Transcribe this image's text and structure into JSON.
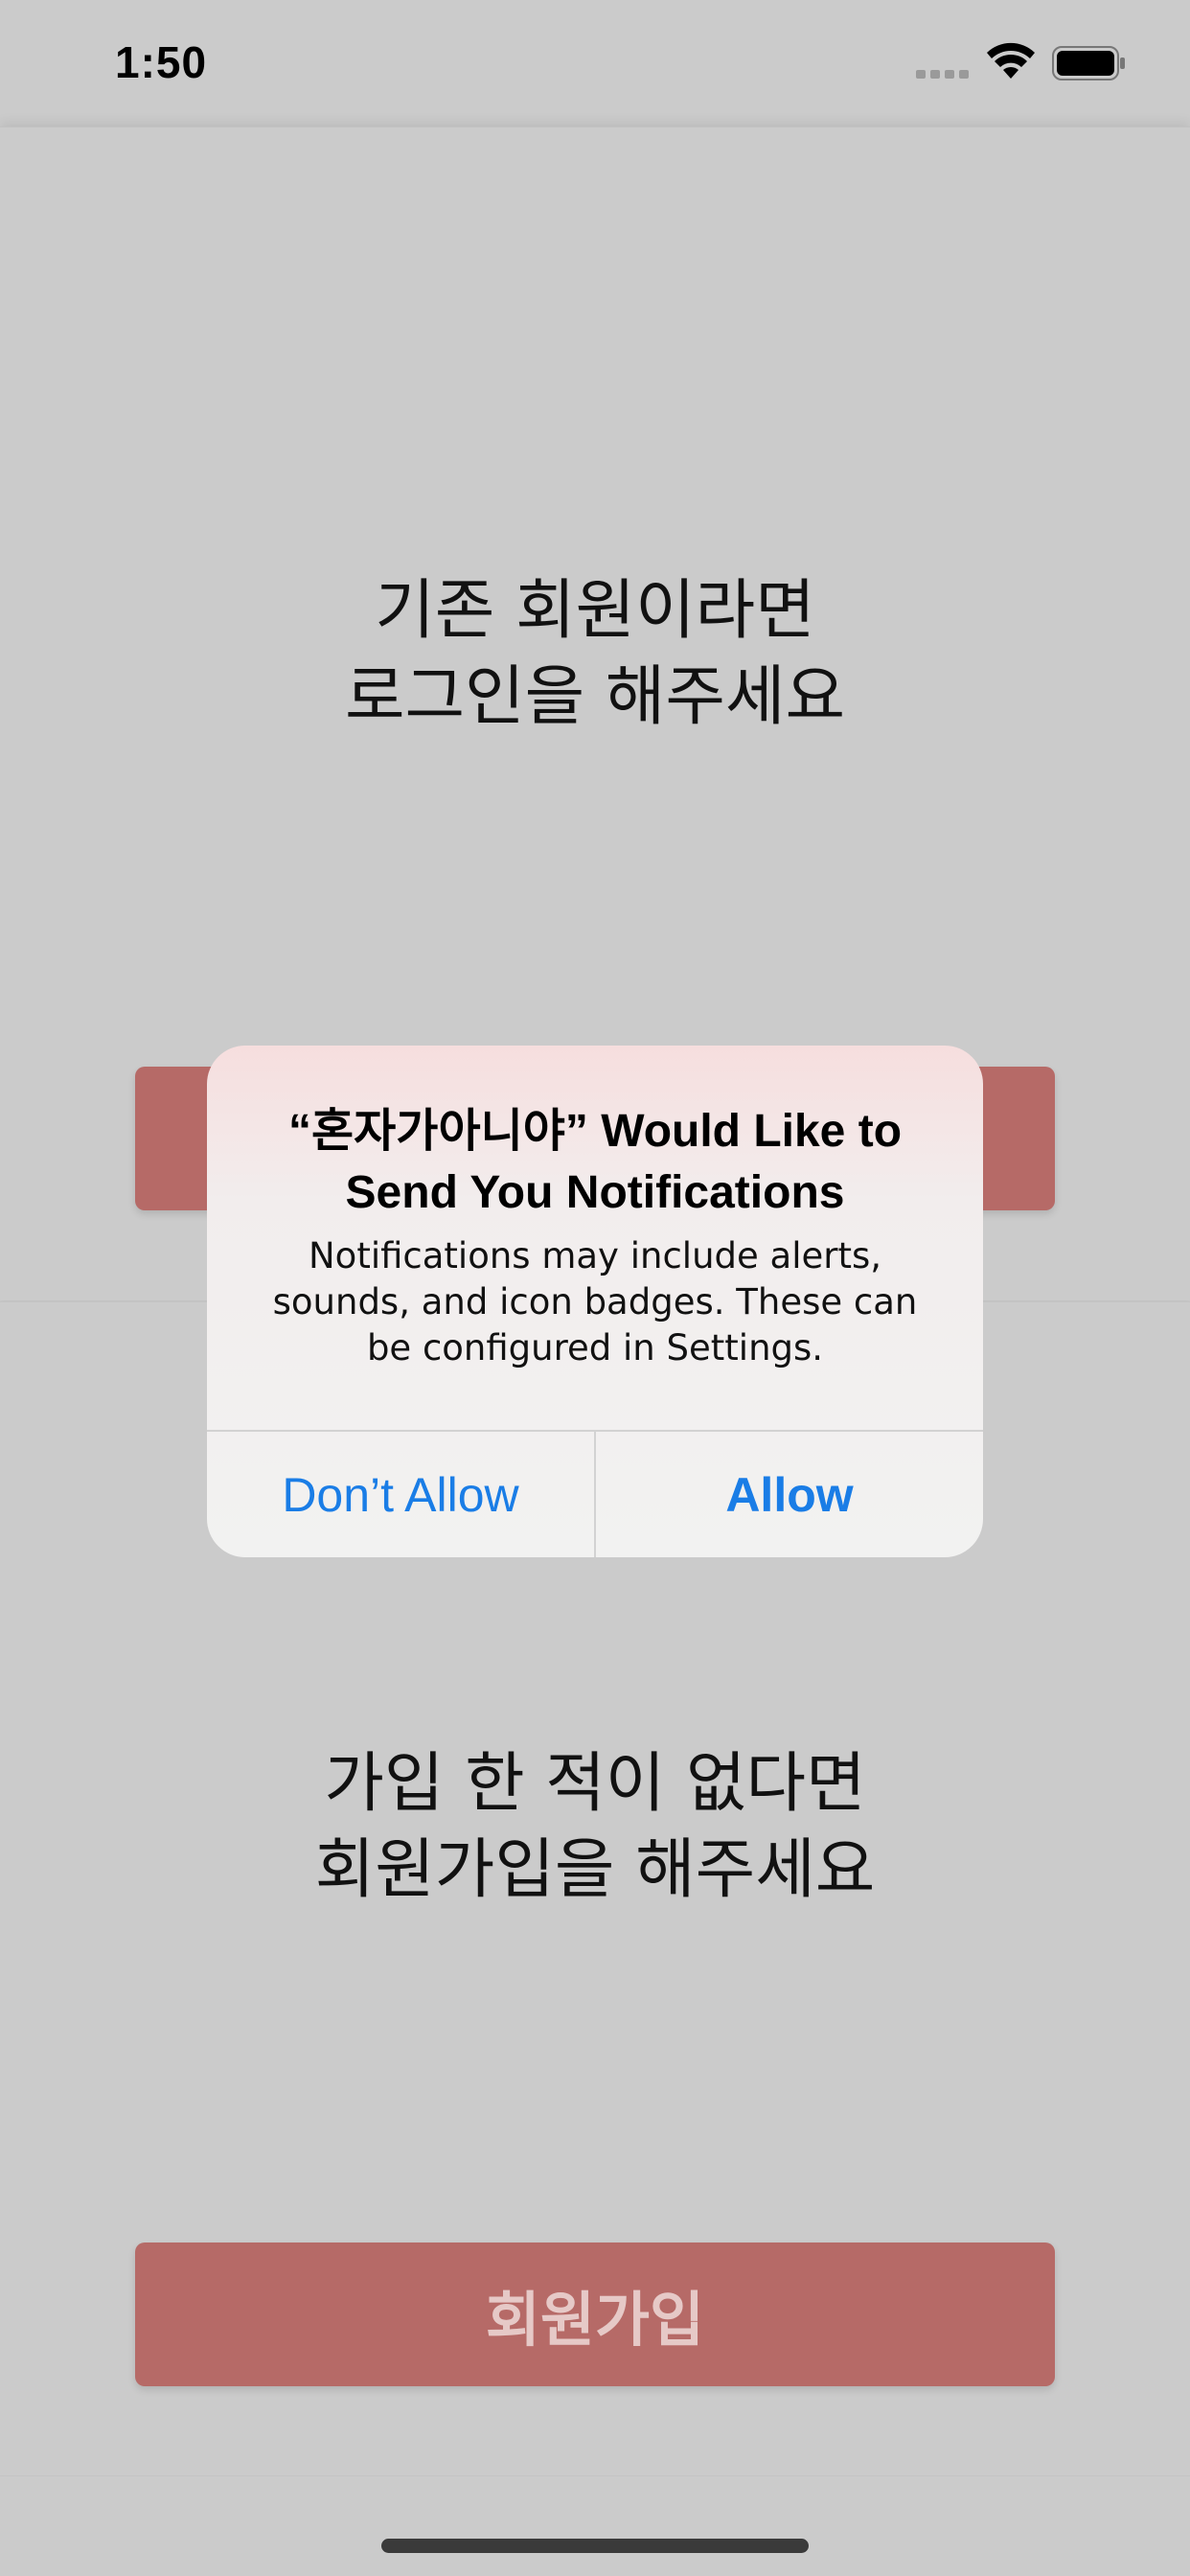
{
  "status_bar": {
    "time": "1:50",
    "icons": [
      "signal-icon",
      "wifi-icon",
      "battery-icon"
    ]
  },
  "login_section": {
    "prompt_lines": [
      "기존 회원이라면",
      "로그인을 해주세요"
    ]
  },
  "signup_section": {
    "prompt_lines": [
      "가입 한 적이 없다면",
      "회원가입을 해주세요"
    ],
    "button_label": "회원가입"
  },
  "alert": {
    "title_lines": [
      "“혼자가아니야” Would Like to",
      "Send You Notifications"
    ],
    "message_lines": [
      "Notifications may include alerts,",
      "sounds, and icon badges. These can",
      "be configured in Settings."
    ],
    "dont_allow_label": "Don’t Allow",
    "allow_label": "Allow"
  },
  "colors": {
    "background": "#cbcbcb",
    "button": "#b66a67",
    "button_text": "#e6c9c7",
    "alert_action": "#1a7de6"
  }
}
